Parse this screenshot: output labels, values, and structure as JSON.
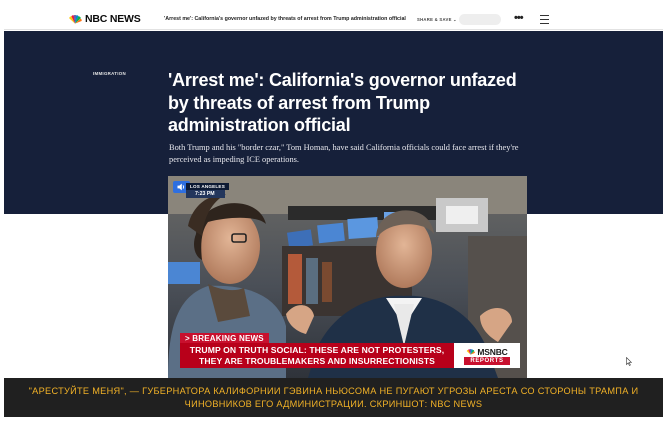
{
  "nav": {
    "logo_text": "NBC NEWS",
    "headline": "'Arrest me': California's governor unfazed by threats of arrest from Trump administration official",
    "share_label": "SHARE & SAVE",
    "share_chevron": "⌄",
    "more_label": "•••"
  },
  "article": {
    "category": "IMMIGRATION",
    "headline": "'Arrest me': California's governor unfazed by threats of arrest from Trump administration official",
    "dek": "Both Trump and his \"border czar,\" Tom Homan, have said California officials could face arrest if they're perceived as impeding ICE operations."
  },
  "video": {
    "location": "LOS ANGELES",
    "time": "7:23 PM",
    "breaking_label": "> BREAKING NEWS",
    "ticker_line1": "TRUMP ON TRUTH SOCIAL: THESE ARE NOT PROTESTERS,",
    "ticker_line2": "THEY ARE TROUBLEMAKERS AND INSURRECTIONISTS",
    "brand": "MSNBC",
    "brand_sub": "REPORTS"
  },
  "caption": {
    "text": "\"АРЕСТУЙТЕ МЕНЯ\", — ГУБЕРНАТОРА КАЛИФОРНИИ ГЭВИНА НЬЮСОМА НЕ ПУГАЮТ УГРОЗЫ АРЕСТА СО СТОРОНЫ ТРАМПА И ЧИНОВНИКОВ ЕГО АДМИНИСТРАЦИИ. СКРИНШОТ: NBC NEWS"
  },
  "colors": {
    "hero_bg": "#16203a",
    "breaking_red": "#c8102e",
    "caption_text": "#f2b227",
    "mute_blue": "#2e6fe0"
  },
  "icons": [
    "nbc-peacock-icon",
    "hamburger-menu-icon",
    "more-dots-icon",
    "speaker-icon",
    "cursor-icon",
    "msnbc-peacock-icon"
  ]
}
